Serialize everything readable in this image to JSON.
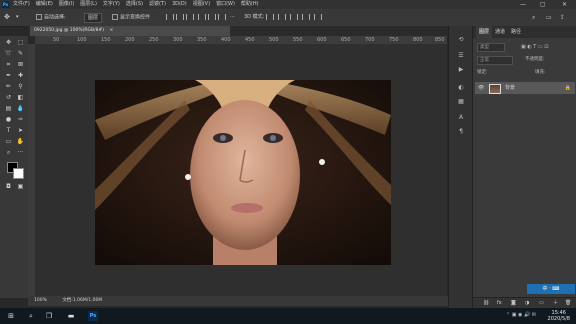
{
  "menubar": {
    "logo": "Ps",
    "items": [
      "文件(F)",
      "编辑(E)",
      "图像(I)",
      "图层(L)",
      "文字(Y)",
      "选择(S)",
      "滤镜(T)",
      "3D(D)",
      "视图(V)",
      "窗口(W)",
      "帮助(H)"
    ],
    "minimize": "—",
    "maximize": "▢",
    "close": "✕"
  },
  "options": {
    "auto_select_label": "自动选择:",
    "layer_select_value": "图层",
    "transform_controls_label": "显示变换控件",
    "mode_3d_label": "3D 模式:",
    "more": "···"
  },
  "document": {
    "tab_label": "0922050.jpg @ 100%(RGB/8#)",
    "tab_close": "×",
    "ruler_ticks": [
      "50",
      "100",
      "150",
      "200",
      "250",
      "300",
      "350",
      "400",
      "450",
      "500",
      "550",
      "600",
      "650",
      "700",
      "750",
      "800",
      "850"
    ]
  },
  "status": {
    "zoom": "100%",
    "doc_info": "文档:1.06M/1.06M"
  },
  "layers_panel": {
    "tabs": [
      "图层",
      "通道",
      "路径"
    ],
    "kind_label": "类型",
    "blend_mode": "正常",
    "opacity_label": "不透明度:",
    "lock_label": "锁定:",
    "fill_label": "填充:",
    "layer_name": "背景"
  },
  "taskbar": {
    "time": "15:46",
    "date": "2020/5/8",
    "ime": "中 ‧ ⌨"
  },
  "colors": {
    "accent": "#1f6fb5",
    "canvas_bg": "#2f2f2f",
    "panel_bg": "#3a3a3a"
  }
}
